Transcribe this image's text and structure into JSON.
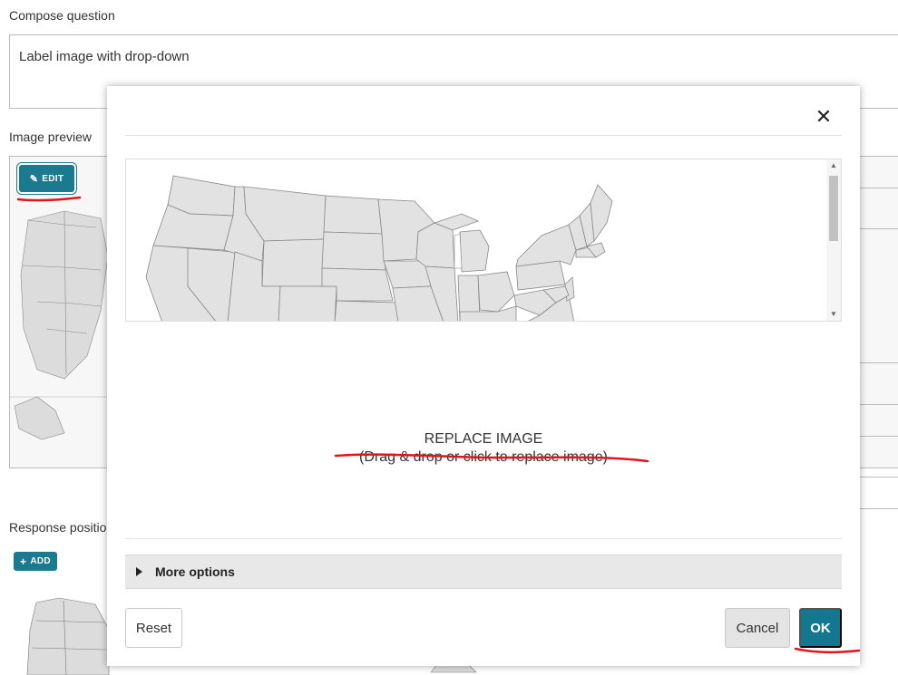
{
  "compose": {
    "label": "Compose question",
    "value": "Label image with drop-down"
  },
  "preview": {
    "label": "Image preview",
    "edit_label": "EDIT"
  },
  "response": {
    "label": "Response positio",
    "add_label": "ADD"
  },
  "modal": {
    "replace_title": "REPLACE IMAGE",
    "replace_sub": "(Drag & drop or click to replace image)",
    "more_options": "More options",
    "reset_label": "Reset",
    "cancel_label": "Cancel",
    "ok_label": "OK"
  },
  "colors": {
    "accent": "#13788f",
    "annotation": "#e0141b"
  },
  "icons": [
    "close-icon",
    "pencil-icon",
    "plus-icon",
    "caret-right-icon",
    "scroll-up-icon",
    "scroll-down-icon"
  ]
}
